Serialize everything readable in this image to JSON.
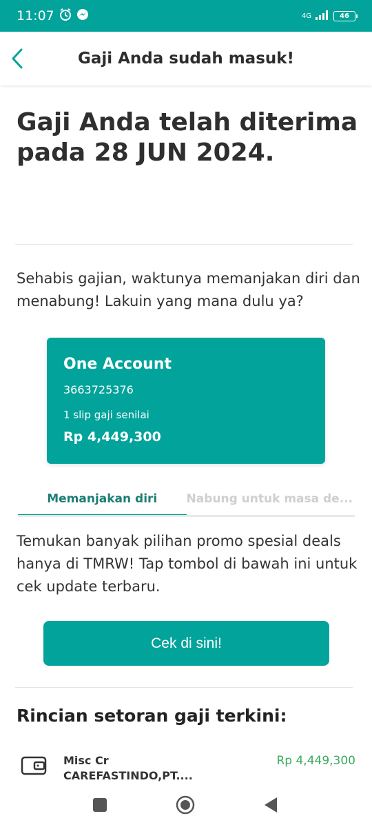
{
  "status_bar": {
    "time": "11:07",
    "network": "4G",
    "battery": "46"
  },
  "header": {
    "title": "Gaji Anda sudah masuk!"
  },
  "main": {
    "title": "Gaji Anda telah diterima pada 28 JUN 2024.",
    "intro": "Sehabis gajian, waktunya memanjakan diri dan menabung! Lakuin yang mana dulu ya?",
    "card": {
      "title": "One Account",
      "account_number": "3663725376",
      "slip_label": "1 slip gaji senilai",
      "amount": "Rp 4,449,300"
    },
    "tabs": [
      {
        "label": "Memanjakan diri",
        "active": true
      },
      {
        "label": "Nabung untuk masa de...",
        "active": false
      }
    ],
    "promo_text": "Temukan banyak pilihan promo spesial deals hanya di TMRW! Tap tombol di bawah ini untuk cek update terbaru.",
    "cta_label": "Cek di sini!",
    "section_title": "Rincian setoran gaji terkini:",
    "transaction": {
      "name": "Misc Cr",
      "sub": "CAREFASTINDO,PT....",
      "amount": "Rp 4,449,300"
    }
  },
  "colors": {
    "accent": "#01a39b",
    "tab_active_text": "#1d7e74",
    "amount_green": "#3dab60"
  },
  "icons": [
    "alarm-icon",
    "messenger-icon",
    "signal-icon",
    "battery-icon",
    "back-arrow-icon",
    "wallet-icon",
    "nav-recents-icon",
    "nav-home-icon",
    "nav-back-icon"
  ]
}
